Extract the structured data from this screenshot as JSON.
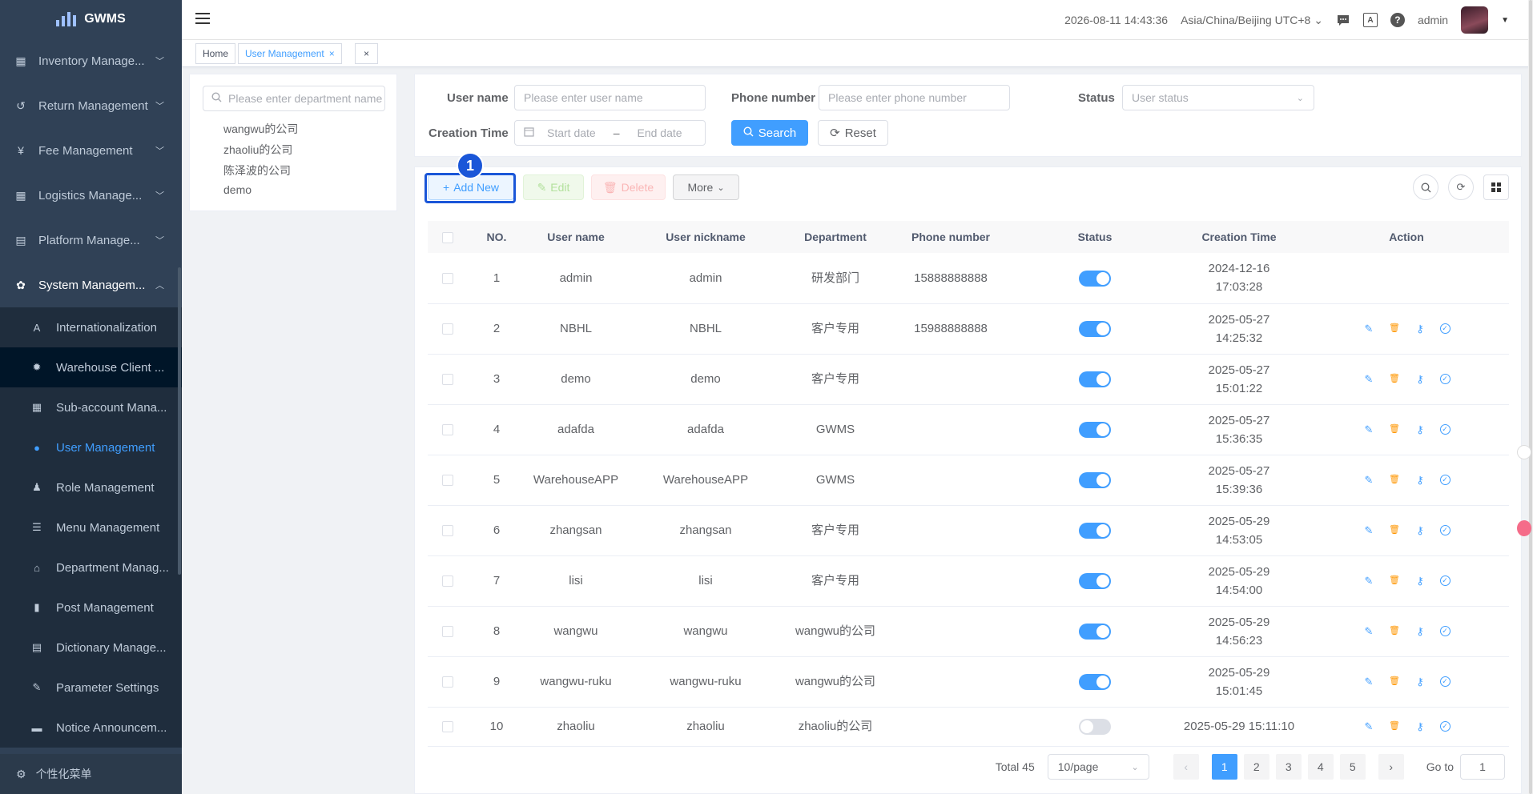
{
  "app": {
    "name": "GWMS"
  },
  "sidebar": {
    "items": [
      {
        "label": "Inventory Manage...",
        "icon": "grid-icon"
      },
      {
        "label": "Return Management",
        "icon": "return-icon"
      },
      {
        "label": "Fee Management",
        "icon": "yen-icon"
      },
      {
        "label": "Logistics Manage...",
        "icon": "apps-icon"
      },
      {
        "label": "Platform Manage...",
        "icon": "building-icon"
      },
      {
        "label": "System Managem...",
        "icon": "gear-icon"
      }
    ],
    "submenu": [
      {
        "label": "Internationalization",
        "icon": "translate-icon"
      },
      {
        "label": "Warehouse Client ...",
        "icon": "bug-icon"
      },
      {
        "label": "Sub-account Mana...",
        "icon": "apps-icon"
      },
      {
        "label": "User Management",
        "icon": "user-icon"
      },
      {
        "label": "Role Management",
        "icon": "users-icon"
      },
      {
        "label": "Menu Management",
        "icon": "list-icon"
      },
      {
        "label": "Department Manag...",
        "icon": "tree-icon"
      },
      {
        "label": "Post Management",
        "icon": "post-icon"
      },
      {
        "label": "Dictionary Manage...",
        "icon": "book-icon"
      },
      {
        "label": "Parameter Settings",
        "icon": "edit-icon"
      },
      {
        "label": "Notice Announcem...",
        "icon": "message-icon"
      }
    ],
    "footer": "个性化菜单"
  },
  "header": {
    "datetime": "2026-08-11 14:43:36",
    "timezone": "Asia/China/Beijing UTC+8",
    "username": "admin"
  },
  "tags": {
    "home": "Home",
    "current": "User Management",
    "close": "×"
  },
  "dept": {
    "placeholder": "Please enter department name",
    "items": [
      "wangwu的公司",
      "zhaoliu的公司",
      "陈泽波的公司",
      "demo"
    ]
  },
  "filter": {
    "username_label": "User name",
    "username_placeholder": "Please enter user name",
    "phone_label": "Phone number",
    "phone_placeholder": "Please enter phone number",
    "status_label": "Status",
    "status_placeholder": "User status",
    "time_label": "Creation Time",
    "start_placeholder": "Start date",
    "range_sep": "–",
    "end_placeholder": "End date",
    "search": "Search",
    "reset": "Reset"
  },
  "toolbar": {
    "add": "Add New",
    "edit": "Edit",
    "delete": "Delete",
    "more": "More",
    "step": "1"
  },
  "table": {
    "headers": [
      "NO.",
      "User name",
      "User nickname",
      "Department",
      "Phone number",
      "Status",
      "Creation Time",
      "Action"
    ],
    "rows": [
      {
        "no": "1",
        "user": "admin",
        "nick": "admin",
        "dept": "研发部门",
        "phone": "15888888888",
        "on": true,
        "date": "2024-12-16",
        "time": "17:03:28",
        "actions": false
      },
      {
        "no": "2",
        "user": "NBHL",
        "nick": "NBHL",
        "dept": "客户专用",
        "phone": "15988888888",
        "on": true,
        "date": "2025-05-27",
        "time": "14:25:32",
        "actions": true
      },
      {
        "no": "3",
        "user": "demo",
        "nick": "demo",
        "dept": "客户专用",
        "phone": "",
        "on": true,
        "date": "2025-05-27",
        "time": "15:01:22",
        "actions": true
      },
      {
        "no": "4",
        "user": "adafda",
        "nick": "adafda",
        "dept": "GWMS",
        "phone": "",
        "on": true,
        "date": "2025-05-27",
        "time": "15:36:35",
        "actions": true
      },
      {
        "no": "5",
        "user": "WarehouseAPP",
        "nick": "WarehouseAPP",
        "dept": "GWMS",
        "phone": "",
        "on": true,
        "date": "2025-05-27",
        "time": "15:39:36",
        "actions": true
      },
      {
        "no": "6",
        "user": "zhangsan",
        "nick": "zhangsan",
        "dept": "客户专用",
        "phone": "",
        "on": true,
        "date": "2025-05-29",
        "time": "14:53:05",
        "actions": true
      },
      {
        "no": "7",
        "user": "lisi",
        "nick": "lisi",
        "dept": "客户专用",
        "phone": "",
        "on": true,
        "date": "2025-05-29",
        "time": "14:54:00",
        "actions": true
      },
      {
        "no": "8",
        "user": "wangwu",
        "nick": "wangwu",
        "dept": "wangwu的公司",
        "phone": "",
        "on": true,
        "date": "2025-05-29",
        "time": "14:56:23",
        "actions": true
      },
      {
        "no": "9",
        "user": "wangwu-ruku",
        "nick": "wangwu-ruku",
        "dept": "wangwu的公司",
        "phone": "",
        "on": true,
        "date": "2025-05-29",
        "time": "15:01:45",
        "actions": true
      },
      {
        "no": "10",
        "user": "zhaoliu",
        "nick": "zhaoliu",
        "dept": "zhaoliu的公司",
        "phone": "",
        "on": false,
        "date": "2025-05-29 15:11:10",
        "time": "",
        "actions": true
      }
    ]
  },
  "pager": {
    "total": "Total 45",
    "size": "10/page",
    "pages": [
      "1",
      "2",
      "3",
      "4",
      "5"
    ],
    "goto_label": "Go to",
    "goto_value": "1"
  },
  "colors": {
    "accent": "#409eff",
    "sidebar_bg": "#304156",
    "highlight": "#1a56d8"
  }
}
